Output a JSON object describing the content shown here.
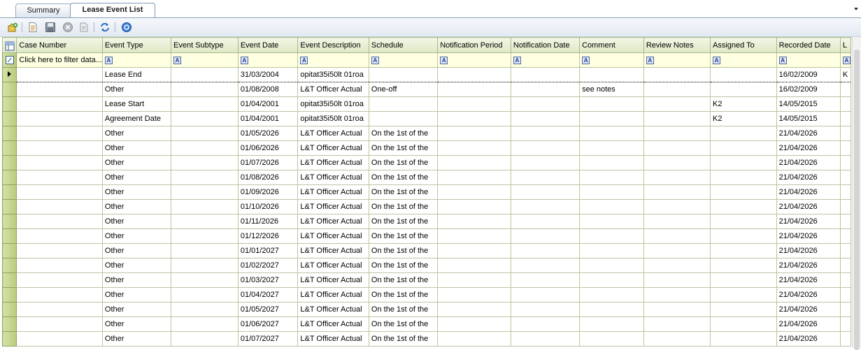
{
  "tabs": [
    {
      "label": "Summary"
    },
    {
      "label": "Lease Event List"
    }
  ],
  "toolbar": {
    "icons": [
      "add-record-icon",
      "new-document-icon",
      "save-icon",
      "delete-icon",
      "print-icon",
      "refresh-icon",
      "help-icon"
    ]
  },
  "grid": {
    "columns": [
      "Case Number",
      "Event Type",
      "Event Subtype",
      "Event Date",
      "Event Description",
      "Schedule",
      "Notification Period",
      "Notification Date",
      "Comment",
      "Review Notes",
      "Assigned To",
      "Recorded Date",
      "L"
    ],
    "filter_placeholder": "Click here to filter data...",
    "rows": [
      [
        "",
        "Lease End",
        "",
        "31/03/2004",
        "opitat35i50lt 01roa",
        "",
        "",
        "",
        "",
        "",
        "",
        "16/02/2009",
        "K"
      ],
      [
        "",
        "Other",
        "",
        "01/08/2008",
        "L&T Officer Actual",
        "One-off",
        "",
        "",
        "see notes",
        "",
        "",
        "16/02/2009",
        ""
      ],
      [
        "",
        "Lease Start",
        "",
        "01/04/2001",
        "opitat35i50lt 01roa",
        "",
        "",
        "",
        "",
        "",
        "K2",
        "14/05/2015",
        ""
      ],
      [
        "",
        "Agreement Date",
        "",
        "01/04/2001",
        "opitat35i50lt 01roa",
        "",
        "",
        "",
        "",
        "",
        "K2",
        "14/05/2015",
        ""
      ],
      [
        "",
        "Other",
        "",
        "01/05/2026",
        "L&T Officer Actual",
        "On the 1st of the",
        "",
        "",
        "",
        "",
        "",
        "21/04/2026",
        ""
      ],
      [
        "",
        "Other",
        "",
        "01/06/2026",
        "L&T Officer Actual",
        "On the 1st of the",
        "",
        "",
        "",
        "",
        "",
        "21/04/2026",
        ""
      ],
      [
        "",
        "Other",
        "",
        "01/07/2026",
        "L&T Officer Actual",
        "On the 1st of the",
        "",
        "",
        "",
        "",
        "",
        "21/04/2026",
        ""
      ],
      [
        "",
        "Other",
        "",
        "01/08/2026",
        "L&T Officer Actual",
        "On the 1st of the",
        "",
        "",
        "",
        "",
        "",
        "21/04/2026",
        ""
      ],
      [
        "",
        "Other",
        "",
        "01/09/2026",
        "L&T Officer Actual",
        "On the 1st of the",
        "",
        "",
        "",
        "",
        "",
        "21/04/2026",
        ""
      ],
      [
        "",
        "Other",
        "",
        "01/10/2026",
        "L&T Officer Actual",
        "On the 1st of the",
        "",
        "",
        "",
        "",
        "",
        "21/04/2026",
        ""
      ],
      [
        "",
        "Other",
        "",
        "01/11/2026",
        "L&T Officer Actual",
        "On the 1st of the",
        "",
        "",
        "",
        "",
        "",
        "21/04/2026",
        ""
      ],
      [
        "",
        "Other",
        "",
        "01/12/2026",
        "L&T Officer Actual",
        "On the 1st of the",
        "",
        "",
        "",
        "",
        "",
        "21/04/2026",
        ""
      ],
      [
        "",
        "Other",
        "",
        "01/01/2027",
        "L&T Officer Actual",
        "On the 1st of the",
        "",
        "",
        "",
        "",
        "",
        "21/04/2026",
        ""
      ],
      [
        "",
        "Other",
        "",
        "01/02/2027",
        "L&T Officer Actual",
        "On the 1st of the",
        "",
        "",
        "",
        "",
        "",
        "21/04/2026",
        ""
      ],
      [
        "",
        "Other",
        "",
        "01/03/2027",
        "L&T Officer Actual",
        "On the 1st of the",
        "",
        "",
        "",
        "",
        "",
        "21/04/2026",
        ""
      ],
      [
        "",
        "Other",
        "",
        "01/04/2027",
        "L&T Officer Actual",
        "On the 1st of the",
        "",
        "",
        "",
        "",
        "",
        "21/04/2026",
        ""
      ],
      [
        "",
        "Other",
        "",
        "01/05/2027",
        "L&T Officer Actual",
        "On the 1st of the",
        "",
        "",
        "",
        "",
        "",
        "21/04/2026",
        ""
      ],
      [
        "",
        "Other",
        "",
        "01/06/2027",
        "L&T Officer Actual",
        "On the 1st of the",
        "",
        "",
        "",
        "",
        "",
        "21/04/2026",
        ""
      ],
      [
        "",
        "Other",
        "",
        "01/07/2027",
        "L&T Officer Actual",
        "On the 1st of the",
        "",
        "",
        "",
        "",
        "",
        "21/04/2026",
        ""
      ]
    ]
  }
}
